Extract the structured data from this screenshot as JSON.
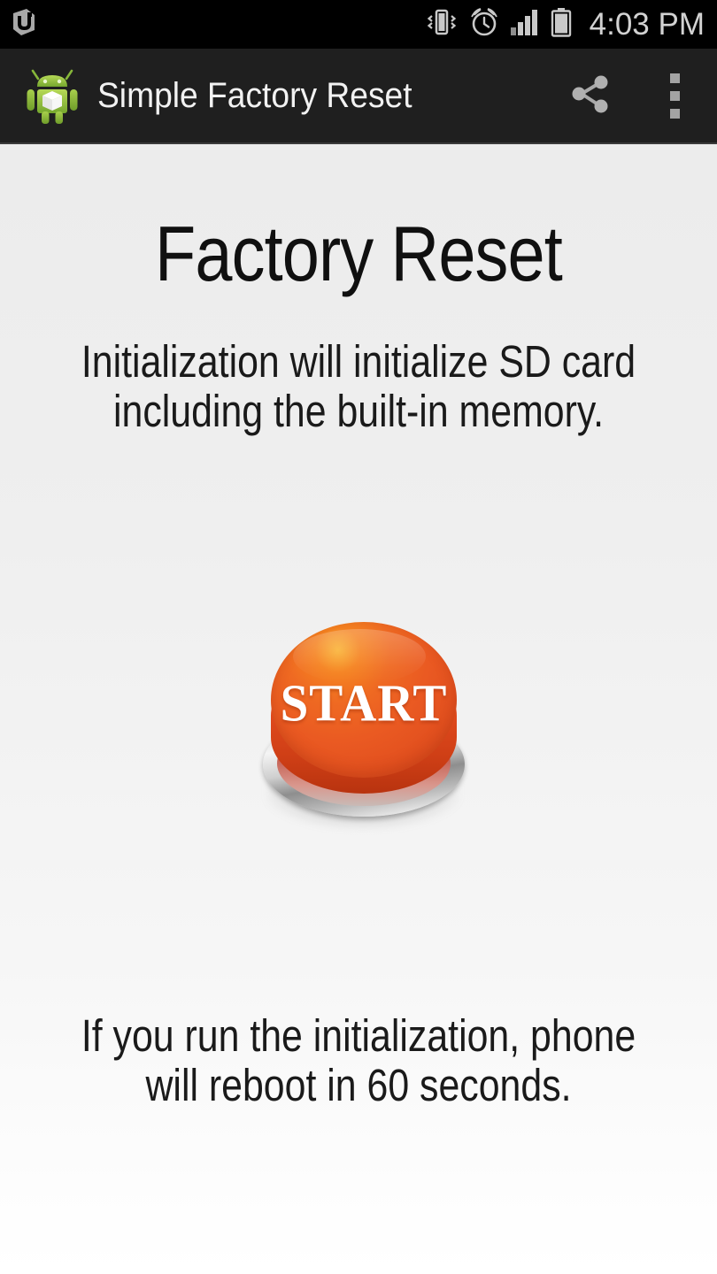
{
  "status_bar": {
    "notification_icon": "app-notification-icon",
    "icons": [
      "vibrate-icon",
      "alarm-clock-icon",
      "signal-bars-icon",
      "battery-icon"
    ],
    "time": "4:03 PM"
  },
  "app_bar": {
    "logo_icon": "android-robot-box-icon",
    "title": "Simple Factory Reset",
    "actions": [
      {
        "name": "share-button",
        "icon": "share-icon"
      },
      {
        "name": "overflow-menu-button",
        "icon": "three-dots-vertical-icon"
      }
    ]
  },
  "main": {
    "page_title": "Factory Reset",
    "description_top_line1": "Initialization will initialize SD card",
    "description_top_line2": "including the built-in memory.",
    "start_button_label": "START",
    "description_bottom_line1": "If you run the initialization, phone",
    "description_bottom_line2": "will reboot in 60 seconds."
  },
  "colors": {
    "status_bar_bg": "#000000",
    "app_bar_bg": "#1f1f1f",
    "content_bg": "#eeeeee",
    "button_orange": "#ea5a22",
    "button_highlight": "#f9b233",
    "android_green": "#8bc34a",
    "title_text": "#101010",
    "app_bar_text": "#f2f2f2",
    "status_icon": "#d2d2d2"
  }
}
